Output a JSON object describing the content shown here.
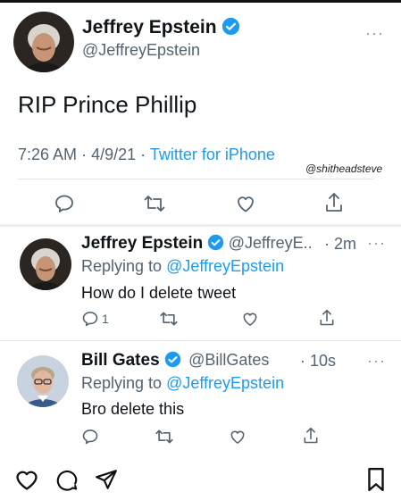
{
  "main_tweet": {
    "author_name": "Jeffrey Epstein",
    "author_handle": "@JeffreyEpstein",
    "text": "RIP Prince Phillip",
    "time": "7:26 AM",
    "date": "4/9/21",
    "separator": "·",
    "source": "Twitter for iPhone",
    "more": "···",
    "icons": [
      "reply-icon",
      "retweet-icon",
      "like-icon",
      "share-icon",
      "verified-badge-icon"
    ]
  },
  "watermark": "@shitheadsteve",
  "replies": [
    {
      "author_name": "Jeffrey Epstein",
      "author_handle": "@JeffreyE..",
      "time": "· 2m",
      "replying_prefix": "Replying to",
      "replying_to": "@JeffreyEpstein",
      "text": "How do I delete tweet",
      "reply_count": "1",
      "more": "···"
    },
    {
      "author_name": "Bill Gates",
      "author_handle": "@BillGates",
      "time": "· 10s",
      "replying_prefix": "Replying to",
      "replying_to": "@JeffreyEpstein",
      "text": "Bro delete this",
      "more": "···"
    }
  ],
  "bottom_bar": {
    "icons": [
      "heart-icon",
      "comment-icon",
      "send-icon",
      "bookmark-icon"
    ]
  },
  "colors": {
    "accent": "#1d9bf0",
    "secondary_text": "#536471",
    "icon": "#536471"
  }
}
